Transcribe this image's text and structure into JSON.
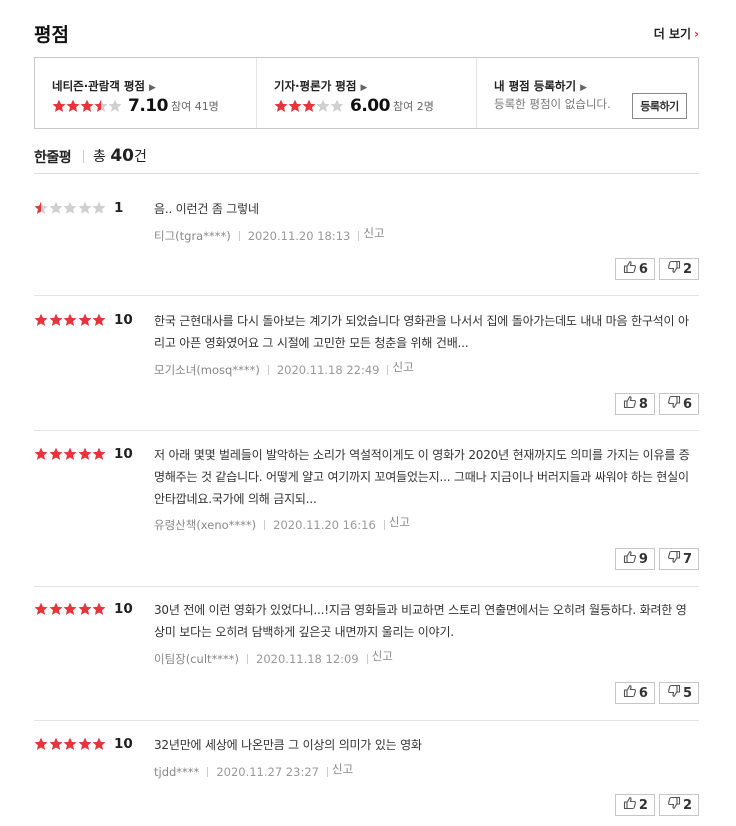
{
  "header": {
    "title": "평점",
    "more_label": "더 보기",
    "more_arrow": "›"
  },
  "summary": {
    "netizen": {
      "title": "네티즌·관람객 평점",
      "score": "7.10",
      "participants": "참여 41명",
      "rating": 3.5
    },
    "critic": {
      "title": "기자·평론가 평점",
      "score": "6.00",
      "participants": "참여 2명",
      "rating": 3
    },
    "mine": {
      "title": "내 평점 등록하기",
      "empty_text": "등록한 평점이 없습니다.",
      "button_label": "등록하기"
    }
  },
  "oneline": {
    "label": "한줄평",
    "total_prefix": "총 ",
    "total_count": "40",
    "total_suffix": "건"
  },
  "colors": {
    "star_on": "#e8333b",
    "star_off": "#d0d0d0"
  },
  "reviews": [
    {
      "rating": 0.5,
      "score": "1",
      "text": "음.. 이런건 좀 그렇네",
      "author": "티그(tgra****)",
      "date": "2020.11.20 18:13",
      "report": "신고",
      "likes": "6",
      "dislikes": "2"
    },
    {
      "rating": 5,
      "score": "10",
      "text": "한국 근현대사를 다시 돌아보는 계기가 되었습니다 영화관을 나서서 집에 돌아가는데도 내내 마음 한구석이 아리고 아픈 영화였어요 그 시절에 고민한 모든 청춘을 위해 건배...",
      "author": "모기소녀(mosq****)",
      "date": "2020.11.18 22:49",
      "report": "신고",
      "likes": "8",
      "dislikes": "6"
    },
    {
      "rating": 5,
      "score": "10",
      "text": "저 아래 몇몇 벌레들이 발악하는 소리가 역설적이게도 이 영화가 2020년 현재까지도 의미를 가지는 이유를 증명해주는 것 같습니다. 어떻게 얄고 여기까지 꼬여들었는지... 그때나 지금이나 버러지들과 싸워야 하는 현실이 안타깝네요.국가에 의해 금지되...",
      "author": "유령산책(xeno****)",
      "date": "2020.11.20 16:16",
      "report": "신고",
      "likes": "9",
      "dislikes": "7"
    },
    {
      "rating": 5,
      "score": "10",
      "text": "30년 전에 이런 영화가 있었다니...!지금 영화들과 비교하면 스토리 연출면에서는 오히려 월등하다. 화려한 영상미 보다는 오히려 담백하게 깊은곳 내면까지 울리는 이야기.",
      "author": "이팀장(cult****)",
      "date": "2020.11.18 12:09",
      "report": "신고",
      "likes": "6",
      "dislikes": "5"
    },
    {
      "rating": 5,
      "score": "10",
      "text": "32년만에 세상에 나온만큼 그 이상의 의미가 있는 영화",
      "author": "tjdd****",
      "date": "2020.11.27 23:27",
      "report": "신고",
      "likes": "2",
      "dislikes": "2"
    }
  ]
}
